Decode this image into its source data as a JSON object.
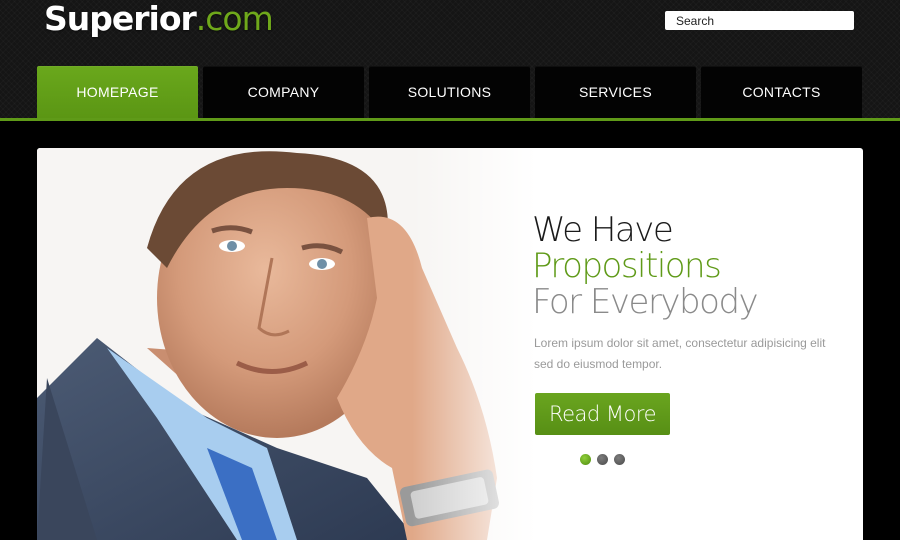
{
  "header": {
    "logo_name": "Superior",
    "logo_tld": ".com",
    "search_placeholder": "Search"
  },
  "nav": {
    "items": [
      {
        "label": "HOMEPAGE",
        "active": true
      },
      {
        "label": "COMPANY",
        "active": false
      },
      {
        "label": "SOLUTIONS",
        "active": false
      },
      {
        "label": "SERVICES",
        "active": false
      },
      {
        "label": "CONTACTS",
        "active": false
      }
    ]
  },
  "hero": {
    "title_line1": "We Have",
    "title_line2": "Propositions",
    "title_line3": "For Everybody",
    "text": "Lorem ipsum dolor sit amet, consectetur adipisicing elit sed do eiusmod tempor.",
    "button_label": "Read More",
    "slides_total": 3,
    "active_slide": 1
  },
  "colors": {
    "accent": "#5f9a18",
    "background": "#000000",
    "header": "#151515"
  }
}
